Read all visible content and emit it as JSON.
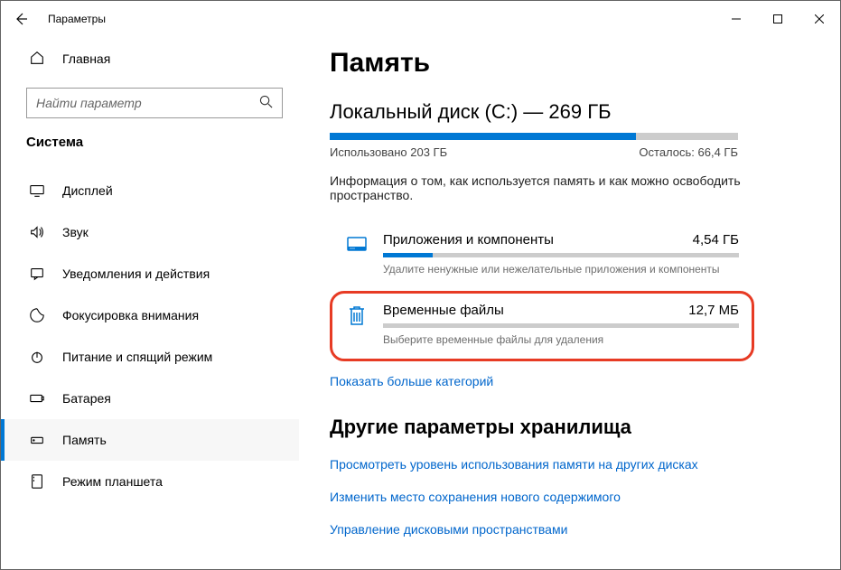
{
  "window": {
    "title": "Параметры"
  },
  "sidebar": {
    "home": "Главная",
    "search_placeholder": "Найти параметр",
    "category": "Система",
    "items": [
      {
        "label": "Дисплей"
      },
      {
        "label": "Звук"
      },
      {
        "label": "Уведомления и действия"
      },
      {
        "label": "Фокусировка внимания"
      },
      {
        "label": "Питание и спящий режим"
      },
      {
        "label": "Батарея"
      },
      {
        "label": "Память"
      },
      {
        "label": "Режим планшета"
      }
    ]
  },
  "main": {
    "title": "Память",
    "disk": {
      "title": "Локальный диск (C:) — 269 ГБ",
      "used_label": "Использовано 203 ГБ",
      "free_label": "Осталось: 66,4 ГБ",
      "used_percent": 75
    },
    "description": "Информация о том, как используется память и как можно освободить пространство.",
    "categories": [
      {
        "name": "Приложения и компоненты",
        "size": "4,54 ГБ",
        "fill_percent": 14,
        "hint": "Удалите ненужные или нежелательные приложения и компоненты"
      },
      {
        "name": "Временные файлы",
        "size": "12,7 МБ",
        "fill_percent": 0,
        "hint": "Выберите временные файлы для удаления"
      }
    ],
    "show_more": "Показать больше категорий",
    "other_title": "Другие параметры хранилища",
    "links": [
      "Просмотреть уровень использования памяти на других дисках",
      "Изменить место сохранения нового содержимого",
      "Управление дисковыми пространствами"
    ]
  }
}
